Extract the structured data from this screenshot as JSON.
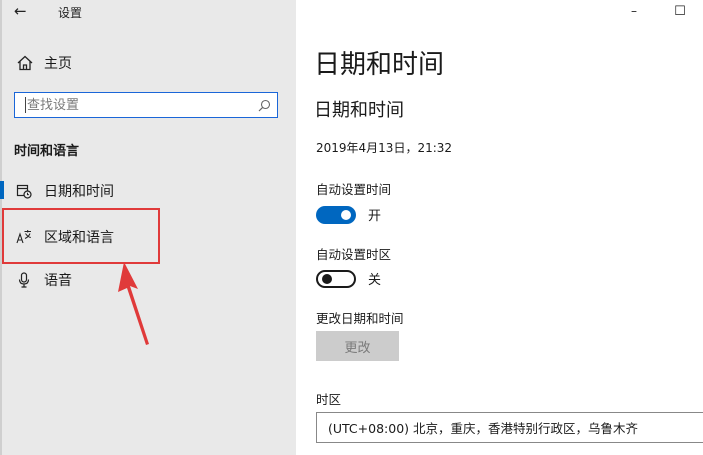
{
  "window": {
    "back_glyph": "←",
    "title": "设置",
    "minimize_glyph": "–",
    "maximize_glyph": "☐"
  },
  "sidebar": {
    "home_label": "主页",
    "search_placeholder": "查找设置",
    "section_header": "时间和语言",
    "items": [
      {
        "label": "日期和时间",
        "icon": "calendar-clock-icon",
        "active": true
      },
      {
        "label": "区域和语言",
        "icon": "region-language-icon",
        "active": false
      },
      {
        "label": "语音",
        "icon": "microphone-icon",
        "active": false
      }
    ]
  },
  "main": {
    "page_title": "日期和时间",
    "sub_title": "日期和时间",
    "current_datetime": "2019年4月13日，21:32",
    "auto_time": {
      "label": "自动设置时间",
      "state": "开",
      "on": true
    },
    "auto_timezone": {
      "label": "自动设置时区",
      "state": "关",
      "on": false
    },
    "change_datetime": {
      "label": "更改日期和时间",
      "button": "更改",
      "enabled": false
    },
    "timezone": {
      "label": "时区",
      "value": "(UTC+08:00) 北京，重庆，香港特别行政区，乌鲁木齐"
    }
  },
  "colors": {
    "accent": "#0067c0",
    "sidebar_bg": "#e9e9e9",
    "annotation": "#e03a3a"
  }
}
